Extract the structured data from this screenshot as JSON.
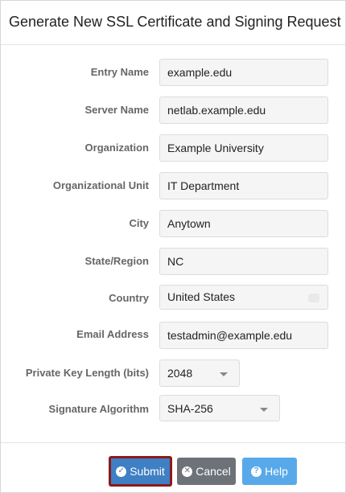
{
  "dialog": {
    "title": "Generate New SSL Certificate and Signing Request"
  },
  "fields": [
    {
      "label": "Entry Name",
      "value": "example.edu"
    },
    {
      "label": "Server Name",
      "value": "netlab.example.edu"
    },
    {
      "label": "Organization",
      "value": "Example University"
    },
    {
      "label": "Organizational Unit",
      "value": "IT Department"
    },
    {
      "label": "City",
      "value": "Anytown"
    },
    {
      "label": "State/Region",
      "value": "NC"
    },
    {
      "label": "Country",
      "value": "United States"
    },
    {
      "label": "Email Address",
      "value": "testadmin@example.edu"
    },
    {
      "label": "Private Key Length (bits)",
      "value": "2048"
    },
    {
      "label": "Signature Algorithm",
      "value": "SHA-256"
    }
  ],
  "buttons": {
    "submit": "Submit",
    "cancel": "Cancel",
    "help": "Help"
  },
  "icons": {
    "submit": "check-circle-icon",
    "cancel": "times-circle-icon",
    "help": "question-circle-icon",
    "dropdown": "caret-down-icon"
  },
  "colors": {
    "submit": "#3f7fc3",
    "submit_outline": "#8b1a1a",
    "cancel": "#6d7279",
    "help": "#58a9e9"
  }
}
